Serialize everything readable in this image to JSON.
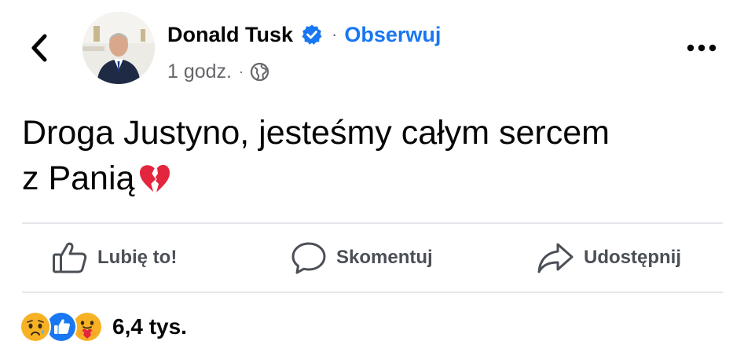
{
  "post": {
    "author": {
      "name": "Donald Tusk",
      "verified": true,
      "follow_label": "Obserwuj",
      "avatar": "avatar-photo"
    },
    "meta": {
      "time": "1 godz.",
      "audience_icon": "globe-icon"
    },
    "header_icons": {
      "back": "chevron-left-icon",
      "more": "more-options-icon"
    },
    "text": {
      "line1": "Droga Justyno, jesteśmy całym sercem",
      "line2": "z Panią",
      "emoji": "broken-heart-emoji"
    },
    "actions": [
      {
        "label": "Lubię to!",
        "icon": "thumbs-up-icon"
      },
      {
        "label": "Skomentuj",
        "icon": "comment-icon"
      },
      {
        "label": "Udostępnij",
        "icon": "share-icon"
      }
    ],
    "reactions": {
      "icons": [
        "sad-reaction-icon",
        "like-reaction-icon",
        "care-reaction-icon"
      ],
      "count": "6,4 tys."
    }
  },
  "colors": {
    "accent": "#1877f2",
    "text": "#050505",
    "secondary_text": "#65676b",
    "divider": "#e4e6eb",
    "broken_heart": "#e3263d",
    "sad_reaction": "#f7b125"
  }
}
